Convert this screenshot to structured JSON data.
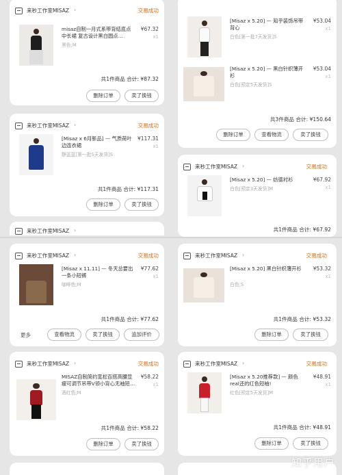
{
  "common": {
    "store_name": "来秒工作室MISAZ",
    "status": "交易成功",
    "qty": "x1",
    "buttons": {
      "delete": "删除订单",
      "resell": "卖了换钱",
      "logistics": "查看物流",
      "review": "追加评价",
      "more": "更多"
    }
  },
  "watermark": "知乎用户",
  "left_col": {
    "card1": {
      "title": "misaz自制一月式系带背结底点中长裙 复古设计黑白圆点…",
      "spec": "黑色;M",
      "price": "¥67.32",
      "summary": "共1件商品 合计: ¥87.32"
    },
    "card2": {
      "title": "[Misaz x 6月新品] — 气质荷叶边连衣裙",
      "spec": "静蓝蓝[第一批S天发货]S",
      "price": "¥117.31",
      "summary": "共1件商品 合计: ¥117.31"
    },
    "card3": {
      "title": "[Misaz x 11.11] — 冬天总要出一条小短裤",
      "spec": "咖啡色;M",
      "price": "¥77.62",
      "summary": "共1件商品 合计: ¥77.62"
    },
    "card4": {
      "title": "MISAZ自制简约宽松百搭高腰显瘦可调节吊带V领小背心无袖短…",
      "spec": "酒红色;M",
      "price": "¥58.22",
      "summary": "共1件商品 合计: ¥58.22"
    }
  },
  "right_col": {
    "card1_item1": {
      "title": "[Misaz x 5.20] — 知乎装饰吊带背心",
      "spec": "白色[第一批7天发货]S",
      "price": "¥53.04"
    },
    "card1_item2": {
      "title": "[Misaz x 5.20] — 黑白针织薄开衫",
      "spec": "白色[预定5天发货]S",
      "price": "¥53.04"
    },
    "card1_summary": "共3件商品 合计: ¥150.64",
    "card2": {
      "title": "[Misaz x 5.20] — 纺德衬衫",
      "spec": "白色[预定3天发货]M",
      "price": "¥67.92",
      "summary": "共1件商品 合计: ¥67.92"
    },
    "card3": {
      "title": "[Misaz x 5.20] 黑白针织薄开衫",
      "spec": "白色;S",
      "price": "¥53.32",
      "summary": "共1件商品 合计: ¥53.32"
    },
    "card4": {
      "title": "[Misaz x 5.20推荐款] — 颜色real还的红色短袖!",
      "spec": "红色[预定5天发货]M",
      "price": "¥48.91",
      "summary": "共1件商品 合计: ¥48.91"
    }
  }
}
